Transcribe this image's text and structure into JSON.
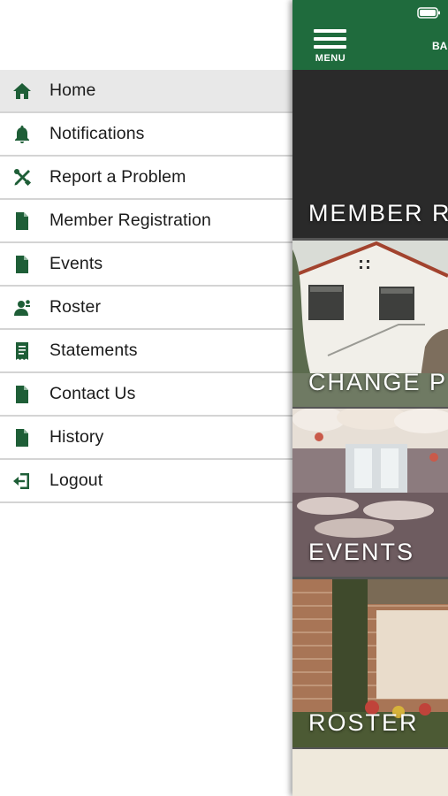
{
  "drawer": {
    "items": [
      {
        "label": "Home",
        "icon": "home-icon",
        "active": true
      },
      {
        "label": "Notifications",
        "icon": "bell-icon",
        "active": false
      },
      {
        "label": "Report a Problem",
        "icon": "tools-icon",
        "active": false
      },
      {
        "label": "Member Registration",
        "icon": "document-icon",
        "active": false
      },
      {
        "label": "Events",
        "icon": "document-icon",
        "active": false
      },
      {
        "label": "Roster",
        "icon": "person-icon",
        "active": false
      },
      {
        "label": "Statements",
        "icon": "statement-icon",
        "active": false
      },
      {
        "label": "Contact Us",
        "icon": "document-icon",
        "active": false
      },
      {
        "label": "History",
        "icon": "document-icon",
        "active": false
      },
      {
        "label": "Logout",
        "icon": "logout-icon",
        "active": false
      }
    ]
  },
  "app": {
    "menu_label": "MENU",
    "header_title": "BA",
    "tiles": [
      {
        "label": "MEMBER R"
      },
      {
        "label": "CHANGE P"
      },
      {
        "label": "EVENTS"
      },
      {
        "label": "ROSTER"
      }
    ]
  },
  "colors": {
    "brand_green": "#1f6b3d",
    "icon_green": "#1e5e37",
    "active_row": "#e8e8e8",
    "divider": "#d4d4d4"
  }
}
